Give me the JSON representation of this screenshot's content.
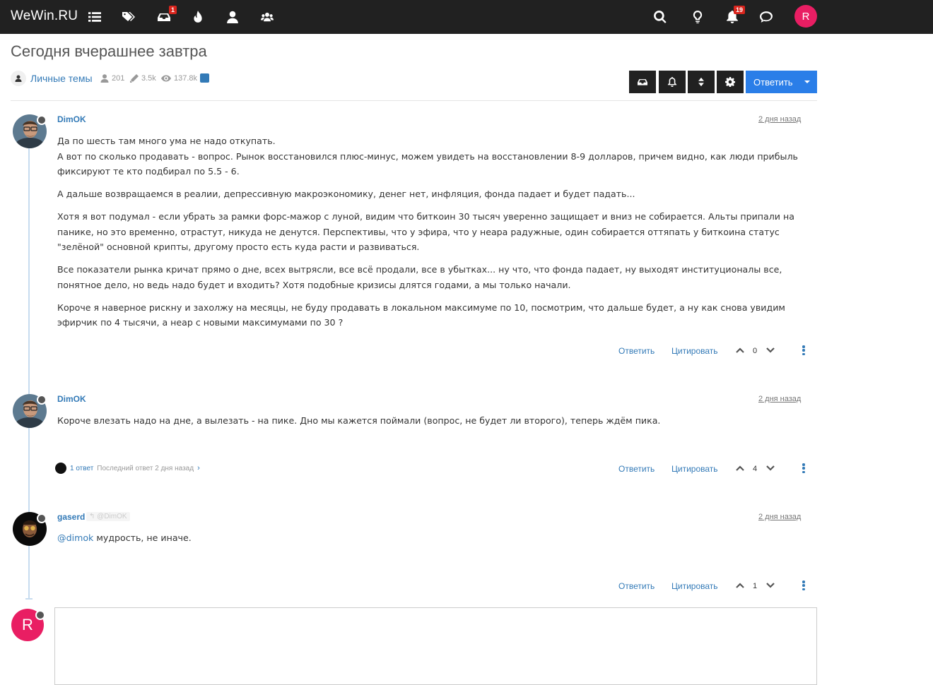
{
  "navbar": {
    "brand": "WeWin.RU",
    "icons": [
      {
        "name": "categories-icon",
        "badge": ""
      },
      {
        "name": "tags-icon",
        "badge": ""
      },
      {
        "name": "unread-icon",
        "badge": "1"
      },
      {
        "name": "popular-icon",
        "badge": ""
      },
      {
        "name": "users-icon",
        "badge": ""
      },
      {
        "name": "groups-icon",
        "badge": ""
      }
    ],
    "right_icons": [
      {
        "name": "search-icon",
        "badge": ""
      },
      {
        "name": "lightbulb-icon",
        "badge": ""
      },
      {
        "name": "notifications-icon",
        "badge": "19"
      },
      {
        "name": "chat-icon",
        "badge": ""
      }
    ],
    "avatar_letter": "R"
  },
  "topic": {
    "title": "Сегодня вчерашнее завтра",
    "category": "Личные темы",
    "stats": {
      "posters": "201",
      "posts": "3.5k",
      "views": "137.8k"
    },
    "reply_button": "Ответить"
  },
  "posts": [
    {
      "author": "DimOK",
      "time": "2 дня назад",
      "paragraphs": [
        "Да по шесть там много ума не надо откупать.\nА вот по сколько продавать - вопрос. Рынок восстановился плюс-минус, можем увидеть на восстановлении 8-9 долларов, причем видно, как люди прибыль фиксируют те кто подбирал по 5.5 - 6.",
        "А дальше возвращаемся в реалии, депрессивную макроэкономику, денег нет, инфляция, фонда падает и будет падать...",
        "Хотя я вот подумал - если убрать за рамки форс-мажор с луной, видим что биткоин 30 тысяч уверенно защищает и вниз не собирается. Альты припали на панике, но это временно, отрастут, никуда не денутся. Перспективы, что у эфира, что у неара радужные, один собирается оттяпать у биткоина статус \"зелёной\" основной крипты, другому просто есть куда расти и развиваться.",
        "Все показатели рынка кричат прямо о дне, всех вытрясли, все всё продали, все в убытках... ну что, что фонда падает, ну выходят институционалы все, понятное дело, но ведь надо будет и входить? Хотя подобные кризисы длятся годами, а мы только начали.",
        "Короче я наверное рискну и захолжу на месяцы, не буду продавать в локальном максимуме по 10, посмотрим, что дальше будет, а ну как снова увидим эфирчик по 4 тысячи, а неар с новыми максимумами по 30 ?"
      ],
      "reply_label": "Ответить",
      "quote_label": "Цитировать",
      "votes": "0"
    },
    {
      "author": "DimOK",
      "time": "2 дня назад",
      "paragraphs": [
        "Короче влезать надо на дне, а вылезать - на пике. Дно мы кажется поймали (вопрос, не будет ли второго), теперь ждём пика."
      ],
      "replies_count": "1 ответ",
      "replies_last": "Последний ответ 2 дня назад",
      "reply_label": "Ответить",
      "quote_label": "Цитировать",
      "votes": "4"
    },
    {
      "author": "gaserd",
      "reply_to": "@DimOK",
      "time": "2 дня назад",
      "mention": "@dimok",
      "text": " мудрость, не иначе.",
      "reply_label": "Ответить",
      "quote_label": "Цитировать",
      "votes": "1"
    }
  ],
  "composer": {
    "avatar_letter": "R"
  }
}
